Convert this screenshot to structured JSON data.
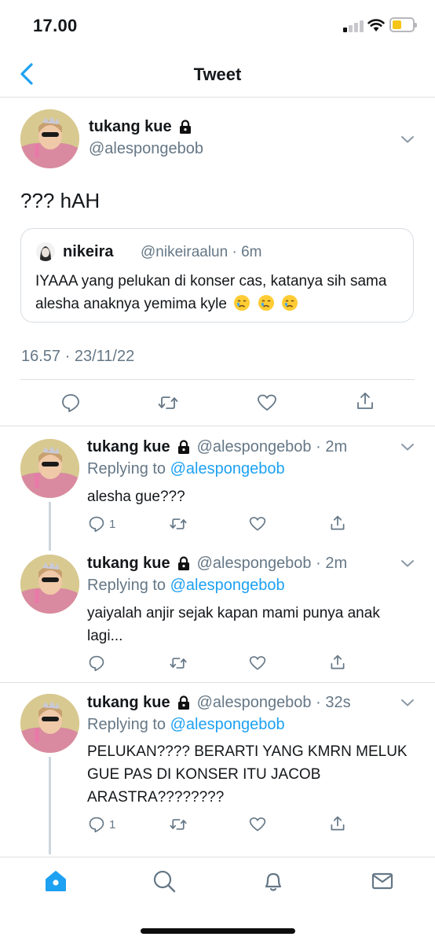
{
  "status_bar": {
    "time": "17.00",
    "battery_color": "#f5c518"
  },
  "nav": {
    "title": "Tweet",
    "back_icon": "chevron-left-icon",
    "accent": "#1da1f2"
  },
  "main_tweet": {
    "name": "tukang kue",
    "handle": "@alespongebob",
    "text": "??? hAH",
    "quote": {
      "name": "nikeira",
      "handle_time": "@nikeiraalun · 6m",
      "text": "IYAAA yang pelukan di konser cas, katanya sih sama alesha anaknya yemima kyle",
      "emoji": "crying-face-icon"
    },
    "timestamp": "16.57 · 23/11/22"
  },
  "replies": [
    {
      "name": "tukang kue",
      "handle_time": "@alespongebob · 2m",
      "replying_label": "Replying to",
      "replying_to": "@alespongebob",
      "text": "alesha gue???",
      "reply_count": "1"
    },
    {
      "name": "tukang kue",
      "handle_time": "@alespongebob · 2m",
      "replying_label": "Replying to",
      "replying_to": "@alespongebob",
      "text": "yaiyalah anjir sejak kapan mami punya anak lagi...",
      "reply_count": ""
    },
    {
      "name": "tukang kue",
      "handle_time": "@alespongebob · 32s",
      "replying_label": "Replying to",
      "replying_to": "@alespongebob",
      "text": "PELUKAN???? BERARTI YANG KMRN MELUK GUE PAS DI KONSER ITU JACOB ARASTRA????????",
      "reply_count": "1"
    }
  ],
  "tab_bar": {
    "items": [
      "home-icon",
      "search-icon",
      "notifications-icon",
      "messages-icon"
    ],
    "active": "home-icon"
  }
}
